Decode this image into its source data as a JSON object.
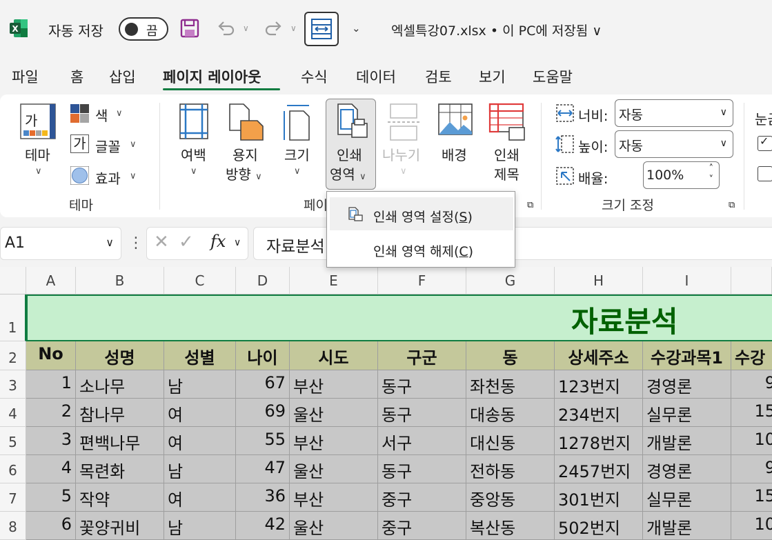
{
  "titlebar": {
    "autosave_label": "자동 저장",
    "autosave_state": "끔",
    "document_title": "엑셀특강07.xlsx • 이 PC에 저장됨 ∨"
  },
  "tabs": [
    "파일",
    "홈",
    "삽입",
    "페이지 레이아웃",
    "수식",
    "데이터",
    "검토",
    "보기",
    "도움말"
  ],
  "active_tab": "페이지 레이아웃",
  "ribbon": {
    "theme_group": {
      "theme_label": "테마",
      "theme_icon_text": "가",
      "colors_label": "색",
      "fonts_label": "글꼴",
      "fonts_icon_text": "가",
      "effects_label": "효과",
      "group_label": "테마"
    },
    "page_setup_group": {
      "margins_label": "여백",
      "orientation_label_1": "용지",
      "orientation_label_2": "방향",
      "size_label": "크기",
      "print_area_label_1": "인쇄",
      "print_area_label_2": "영역",
      "breaks_label": "나누기",
      "background_label": "배경",
      "print_titles_label_1": "인쇄",
      "print_titles_label_2": "제목",
      "group_label": "페이"
    },
    "scale_group": {
      "width_label": "너비:",
      "width_value": "자동",
      "height_label": "높이:",
      "height_value": "자동",
      "scale_label": "배율:",
      "scale_value": "100%",
      "group_label": "크기 조정"
    },
    "sheet_options_group": {
      "gridlines_label": "눈금"
    }
  },
  "formula_bar": {
    "name_box": "A1",
    "fx_label": "fx",
    "formula_value": "자료분석"
  },
  "dropdown": {
    "items": [
      {
        "label": "인쇄 영역 설정(",
        "key": "S",
        "suffix": ")"
      },
      {
        "label": "인쇄 영역 해제(",
        "key": "C",
        "suffix": ")"
      }
    ]
  },
  "sheet": {
    "columns": [
      "A",
      "B",
      "C",
      "D",
      "E",
      "F",
      "G",
      "H",
      "I",
      ""
    ],
    "rows": [
      "1",
      "2",
      "3",
      "4",
      "5",
      "6",
      "7",
      "8"
    ],
    "title": "자료분석",
    "headers": [
      "No",
      "성명",
      "성별",
      "나이",
      "시도",
      "구군",
      "동",
      "상세주소",
      "수강과목1",
      "수강"
    ],
    "data": [
      [
        "1",
        "소나무",
        "남",
        "67",
        "부산",
        "동구",
        "좌천동",
        "123번지",
        "경영론",
        "9"
      ],
      [
        "2",
        "참나무",
        "여",
        "69",
        "울산",
        "동구",
        "대송동",
        "234번지",
        "실무론",
        "15"
      ],
      [
        "3",
        "편백나무",
        "여",
        "55",
        "부산",
        "서구",
        "대신동",
        "1278번지",
        "개발론",
        "10"
      ],
      [
        "4",
        "목련화",
        "남",
        "47",
        "울산",
        "동구",
        "전하동",
        "2457번지",
        "경영론",
        "9"
      ],
      [
        "5",
        "작약",
        "여",
        "36",
        "부산",
        "중구",
        "중앙동",
        "301번지",
        "실무론",
        "15"
      ],
      [
        "6",
        "꽃양귀비",
        "남",
        "42",
        "울산",
        "중구",
        "복산동",
        "502번지",
        "개발론",
        "10"
      ]
    ]
  },
  "colors": {
    "accent": "#107c41",
    "title_band": "#c6efce",
    "title_text": "#006100",
    "header_fill": "#c4c89b",
    "data_fill": "#c8c8c8"
  }
}
